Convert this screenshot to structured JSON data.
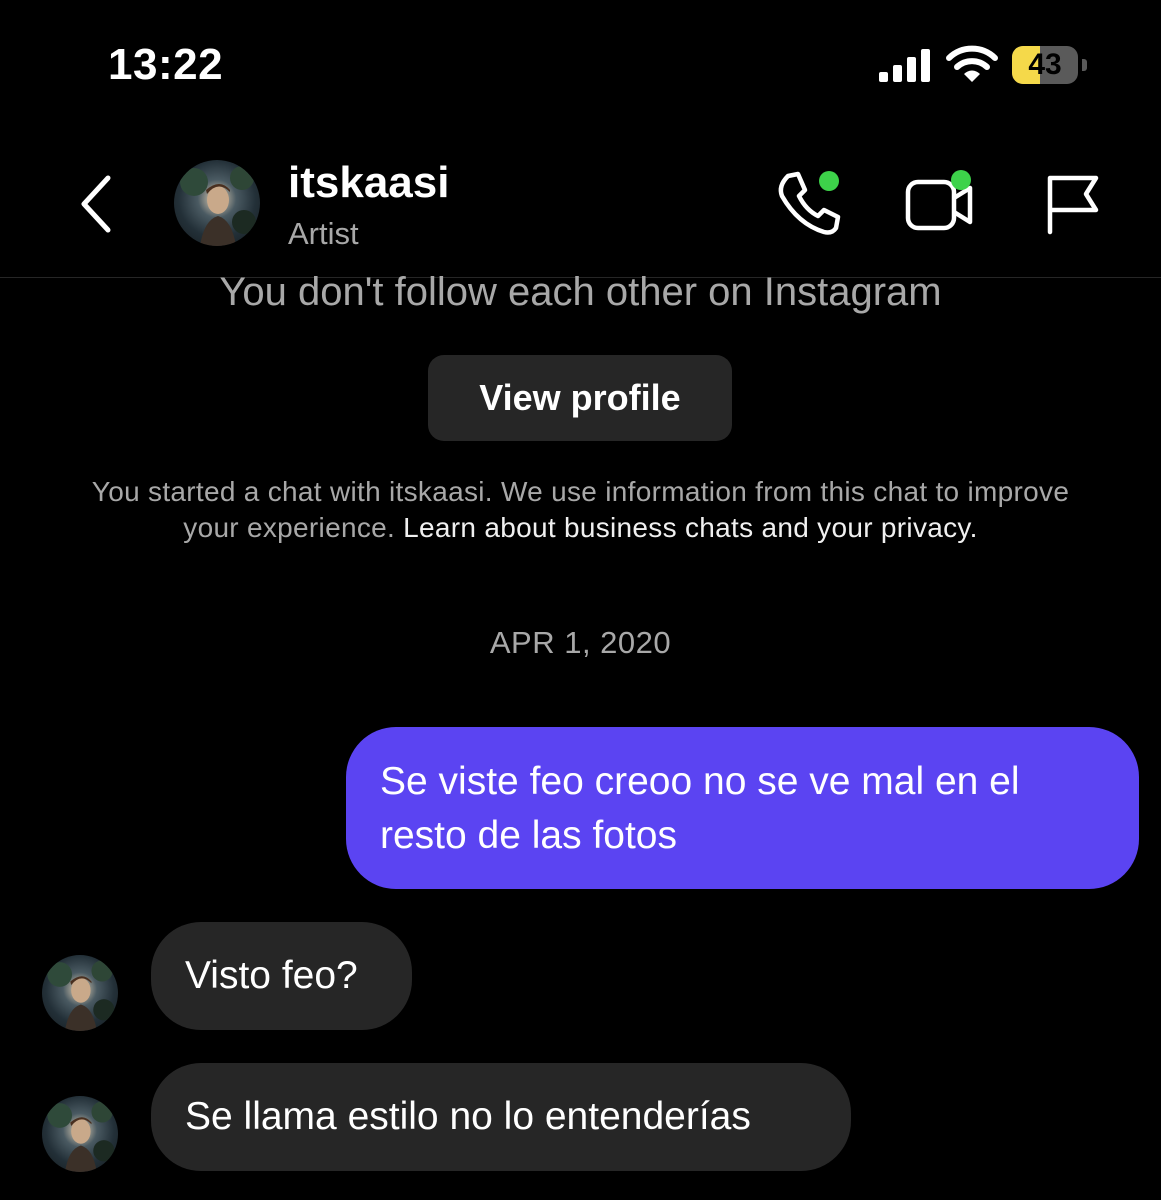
{
  "status_bar": {
    "time": "13:22",
    "battery_level": "43",
    "battery_fraction": 0.43,
    "battery_color": "#f5d94a",
    "icons": [
      "signal-icon",
      "wifi-icon",
      "battery-icon"
    ]
  },
  "header": {
    "username": "itskaasi",
    "subtitle": "Artist",
    "online_dot_color": "#3dd24a",
    "icons": [
      "back-chevron-icon",
      "phone-icon",
      "video-camera-icon",
      "flag-icon"
    ]
  },
  "profile": {
    "follow_note": "You don't follow each other on Instagram",
    "view_profile_label": "View profile",
    "chat_info_text": "You started a chat with itskaasi. We use information from this chat to improve your experience. ",
    "privacy_link": "Learn about business chats and your privacy."
  },
  "thread": {
    "date": "APR 1, 2020",
    "outgoing_color": "#5b44f2",
    "messages": [
      {
        "direction": "outgoing",
        "text": "Se viste feo creoo no se ve mal en el resto de las fotos"
      },
      {
        "direction": "incoming",
        "text": "Visto feo?"
      },
      {
        "direction": "incoming",
        "text": "Se llama estilo no lo entenderías"
      }
    ]
  }
}
